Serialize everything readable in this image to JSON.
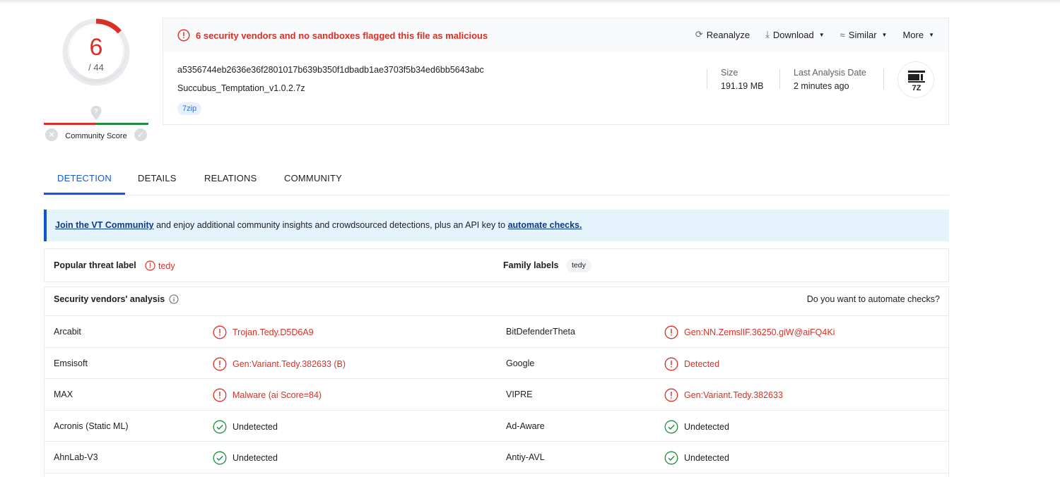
{
  "score": {
    "detections": "6",
    "total": "/ 44",
    "community_label": "Community Score"
  },
  "summary": {
    "alert": "6 security vendors and no sandboxes flagged this file as malicious",
    "actions": {
      "reanalyze": "Reanalyze",
      "download": "Download",
      "similar": "Similar",
      "more": "More"
    },
    "hash": "a5356744eb2636e36f2801017b639b350f1dbadb1ae3703f5b34ed6bb5643abc",
    "filename": "Succubus_Temptation_v1.0.2.7z",
    "tag": "7zip",
    "size_label": "Size",
    "size_value": "191.19 MB",
    "date_label": "Last Analysis Date",
    "date_value": "2 minutes ago",
    "file_type": "7Z"
  },
  "tabs": [
    "DETECTION",
    "DETAILS",
    "RELATIONS",
    "COMMUNITY"
  ],
  "banner": {
    "link1": "Join the VT Community",
    "middle": " and enjoy additional community insights and crowdsourced detections, plus an API key to ",
    "link2": "automate checks."
  },
  "labels": {
    "threat_key": "Popular threat label",
    "threat_value": "tedy",
    "family_key": "Family labels",
    "family_value": "tedy"
  },
  "vendors": {
    "title": "Security vendors' analysis",
    "automate": "Do you want to automate checks?",
    "rows": [
      {
        "left": {
          "name": "Arcabit",
          "result": "Trojan.Tedy.D5D6A9",
          "status": "malicious"
        },
        "right": {
          "name": "BitDefenderTheta",
          "result": "Gen:NN.ZemslIF.36250.giW@aiFQ4Ki",
          "status": "malicious"
        }
      },
      {
        "left": {
          "name": "Emsisoft",
          "result": "Gen:Variant.Tedy.382633 (B)",
          "status": "malicious"
        },
        "right": {
          "name": "Google",
          "result": "Detected",
          "status": "malicious"
        }
      },
      {
        "left": {
          "name": "MAX",
          "result": "Malware (ai Score=84)",
          "status": "malicious"
        },
        "right": {
          "name": "VIPRE",
          "result": "Gen:Variant.Tedy.382633",
          "status": "malicious"
        }
      },
      {
        "left": {
          "name": "Acronis (Static ML)",
          "result": "Undetected",
          "status": "undetected"
        },
        "right": {
          "name": "Ad-Aware",
          "result": "Undetected",
          "status": "undetected"
        }
      },
      {
        "left": {
          "name": "AhnLab-V3",
          "result": "Undetected",
          "status": "undetected"
        },
        "right": {
          "name": "Antiy-AVL",
          "result": "Undetected",
          "status": "undetected"
        }
      }
    ]
  },
  "colors": {
    "malicious": "#d93025",
    "clean": "#1e8e3e",
    "accent": "#1a56db"
  }
}
